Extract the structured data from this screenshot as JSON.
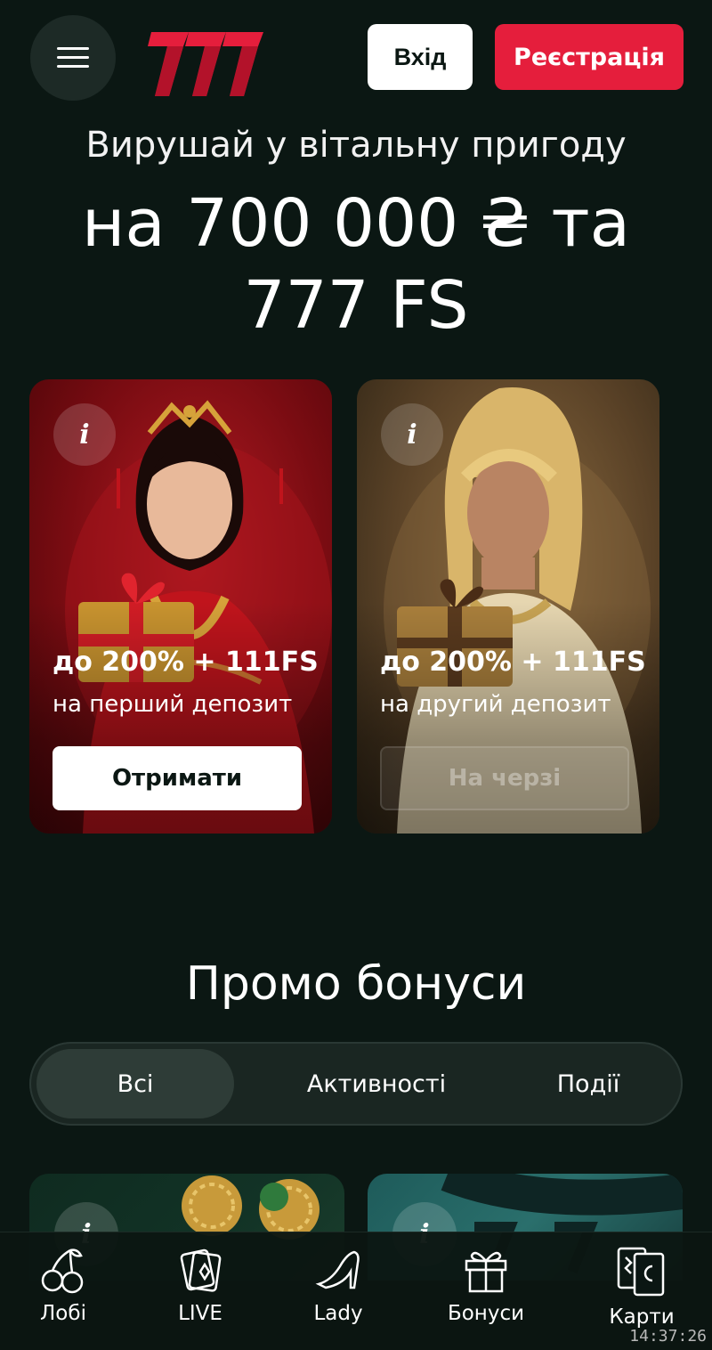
{
  "header": {
    "login_label": "Вхід",
    "register_label": "Реєстрація",
    "logo_text": "777"
  },
  "hero": {
    "subtitle": "Вирушай у вітальну пригоду",
    "title": "на 700 000 ₴ та 777 FS"
  },
  "welcome_cards": [
    {
      "offer": "до 200% + 111FS",
      "description": "на перший депозит",
      "button": "Отримати",
      "button_state": "active",
      "theme": "#8a0f16",
      "info_icon": "info-icon"
    },
    {
      "offer": "до 200% + 111FS",
      "description": "на другий депозит",
      "button": "На черзі",
      "button_state": "disabled",
      "theme": "#6a4e2c",
      "info_icon": "info-icon"
    }
  ],
  "promo": {
    "title": "Промо бонуси",
    "tabs": [
      {
        "label": "Всі",
        "active": true
      },
      {
        "label": "Активності",
        "active": false
      },
      {
        "label": "Події",
        "active": false
      }
    ]
  },
  "bottom_nav": [
    {
      "label": "Лобі",
      "icon": "cherries-icon"
    },
    {
      "label": "LIVE",
      "icon": "cards-icon"
    },
    {
      "label": "Lady",
      "icon": "high-heel-icon"
    },
    {
      "label": "Бонуси",
      "icon": "gift-icon"
    },
    {
      "label": "Карти",
      "icon": "tarot-cards-icon"
    }
  ],
  "status": {
    "time": "14:37:26"
  },
  "colors": {
    "background": "#0b1713",
    "accent": "#e51e3c",
    "tab_active": "#2e3c37"
  }
}
